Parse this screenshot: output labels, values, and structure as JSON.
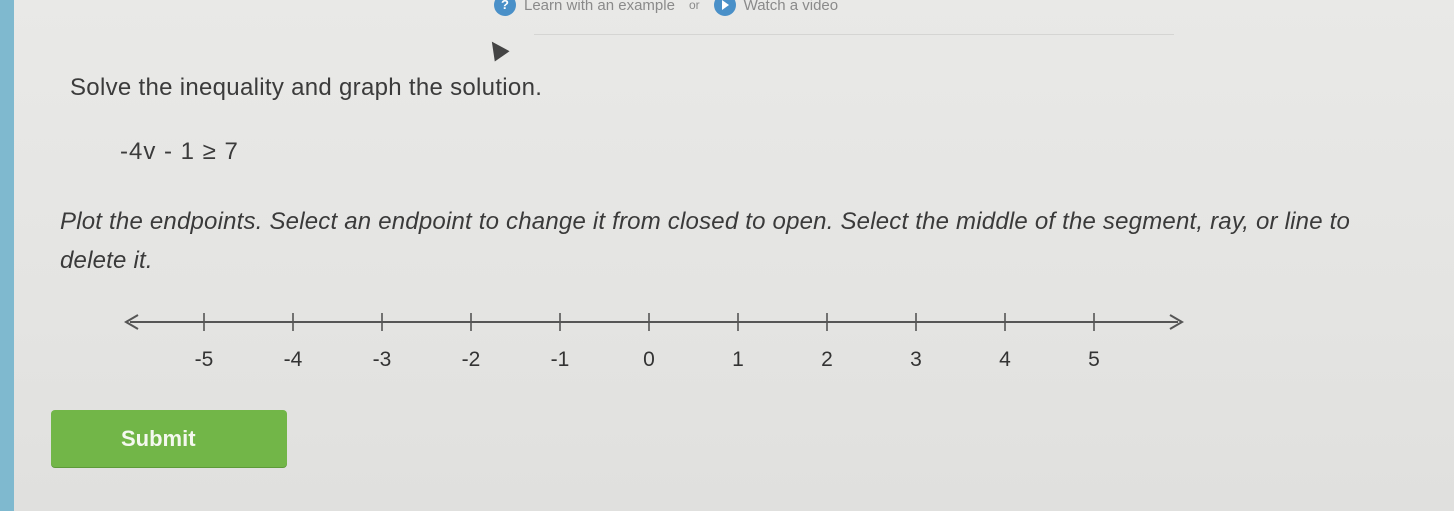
{
  "help": {
    "example_label": "Learn with an example",
    "or_label": "or",
    "video_label": "Watch a video"
  },
  "problem": {
    "instruction": "Solve the inequality and graph the solution.",
    "inequality": "-4v - 1 ≥ 7",
    "directions": "Plot the endpoints. Select an endpoint to change it from closed to open. Select the middle of the segment, ray, or line to delete it."
  },
  "number_line": {
    "min": -5,
    "max": 5,
    "ticks": [
      "-5",
      "-4",
      "-3",
      "-2",
      "-1",
      "0",
      "1",
      "2",
      "3",
      "4",
      "5"
    ]
  },
  "submit": {
    "label": "Submit"
  },
  "colors": {
    "submit_bg": "#72b648",
    "help_icon": "#4a90c8",
    "line": "#555555"
  }
}
